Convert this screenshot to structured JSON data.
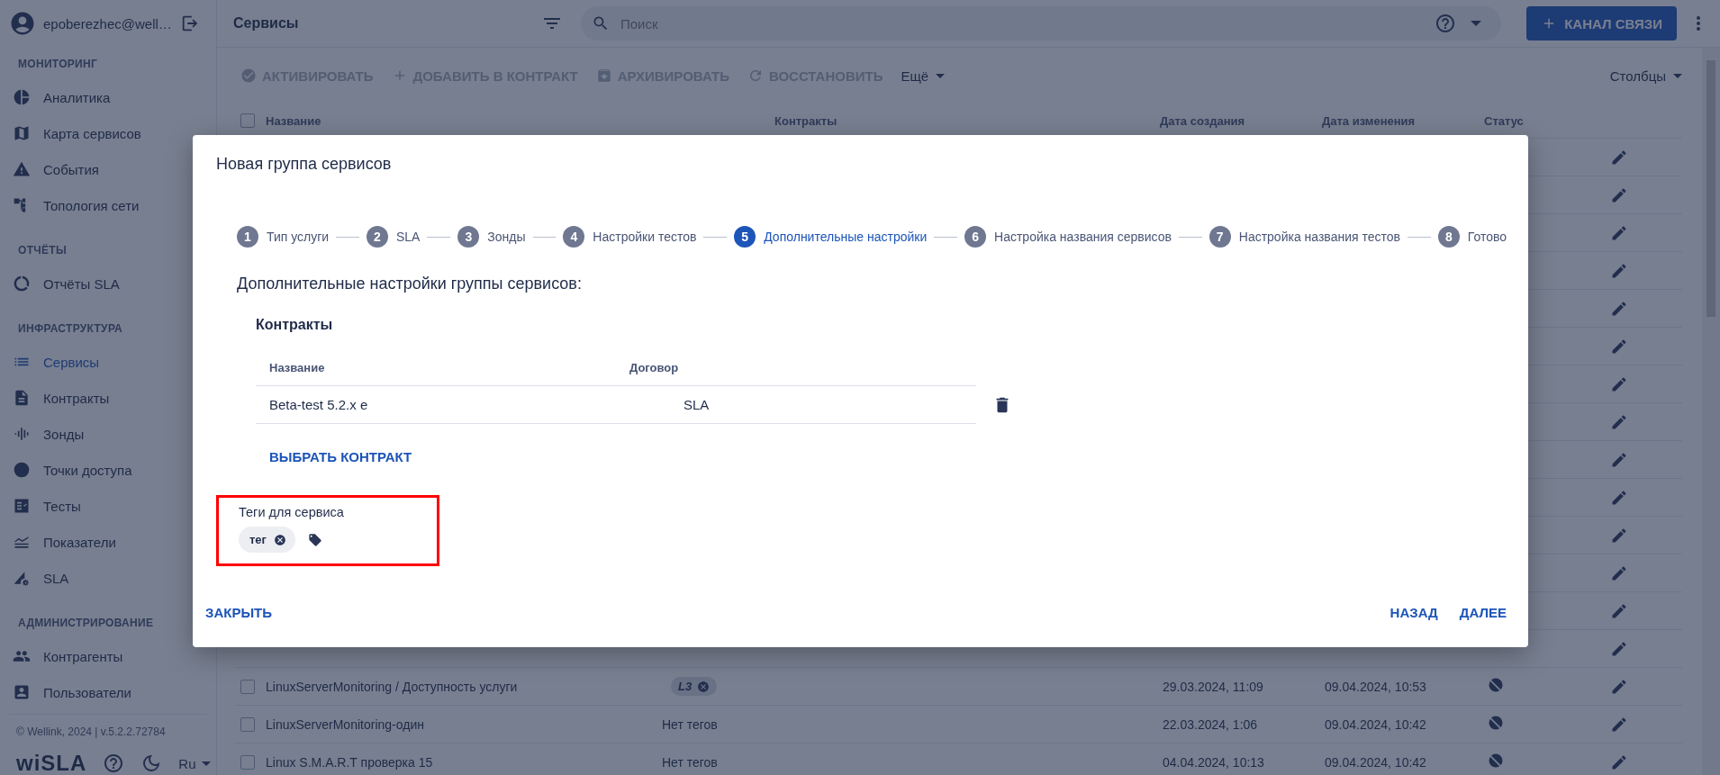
{
  "sidebar": {
    "user": "epoberezhec@well…",
    "sections": [
      {
        "title": "МОНИТОРИНГ",
        "items": [
          {
            "label": "Аналитика",
            "kind": "pie",
            "selected": false
          },
          {
            "label": "Карта сервисов",
            "kind": "map",
            "selected": false
          },
          {
            "label": "События",
            "kind": "warning",
            "selected": false
          },
          {
            "label": "Топология сети",
            "kind": "topology",
            "selected": false
          }
        ]
      },
      {
        "title": "ОТЧЁТЫ",
        "items": [
          {
            "label": "Отчёты SLA",
            "kind": "ring",
            "selected": false
          }
        ]
      },
      {
        "title": "ИНФРАСТРУКТУРА",
        "items": [
          {
            "label": "Сервисы",
            "kind": "list",
            "selected": true
          },
          {
            "label": "Контракты",
            "kind": "document",
            "selected": false
          },
          {
            "label": "Зонды",
            "kind": "wave",
            "selected": false
          },
          {
            "label": "Точки доступа",
            "kind": "dot",
            "selected": false
          },
          {
            "label": "Тесты",
            "kind": "checklist",
            "selected": false
          },
          {
            "label": "Показатели",
            "kind": "lines",
            "selected": false
          },
          {
            "label": "SLA",
            "kind": "slagear",
            "selected": false
          }
        ]
      },
      {
        "title": "АДМИНИСТРИРОВАНИЕ",
        "items": [
          {
            "label": "Контрагенты",
            "kind": "people",
            "selected": false
          },
          {
            "label": "Пользователи",
            "kind": "badge",
            "selected": false
          }
        ]
      }
    ],
    "footer": {
      "copyright": "© Wellink, 2024 | v.5.2.2.72784",
      "logo": "wiSLA",
      "language": "Ru"
    }
  },
  "topbar": {
    "title": "Сервисы",
    "search": {
      "placeholder": "Поиск"
    },
    "primary_button": "КАНАЛ СВЯЗИ"
  },
  "toolbar": {
    "actions": [
      {
        "label": "АКТИВИРОВАТЬ",
        "kind": "activate",
        "disabled": true
      },
      {
        "label": "ДОБАВИТЬ В КОНТРАКТ",
        "kind": "add",
        "disabled": true
      },
      {
        "label": "АРХИВИРОВАТЬ",
        "kind": "archive",
        "disabled": true
      },
      {
        "label": "ВОССТАНОВИТЬ",
        "kind": "restore",
        "disabled": true
      }
    ],
    "more": "Ещё",
    "columns_button": "Столбцы"
  },
  "table": {
    "select_all_checked": false,
    "columns": [
      "Название",
      "Контракты",
      "Дата создания",
      "Дата изменения",
      "Статус"
    ],
    "covered_rows": [
      {
        "kind": "covered"
      },
      {
        "kind": "covered"
      },
      {
        "kind": "covered"
      },
      {
        "kind": "covered"
      },
      {
        "kind": "covered"
      },
      {
        "kind": "covered"
      },
      {
        "kind": "covered"
      },
      {
        "kind": "covered"
      },
      {
        "kind": "covered"
      },
      {
        "kind": "covered"
      },
      {
        "kind": "covered"
      },
      {
        "kind": "covered"
      },
      {
        "kind": "covered"
      },
      {
        "kind": "covered"
      }
    ],
    "rows": [
      {
        "name": "LinuxServerMonitoring / Доступность услуги",
        "tags": [
          "L3"
        ],
        "created": "29.03.2024, 11:09",
        "modified": "09.04.2024, 10:53",
        "checked": false
      },
      {
        "name": "LinuxServerMonitoring-один",
        "tags": [],
        "contracts": "Нет тегов",
        "created": "22.03.2024, 1:06",
        "modified": "09.04.2024, 10:42",
        "checked": false
      },
      {
        "name": "Linux S.M.A.R.T проверка 15",
        "tags": [],
        "contracts": "Нет тегов",
        "created": "04.04.2024, 10:13",
        "modified": "09.04.2024, 10:42",
        "checked": false
      }
    ]
  },
  "modal": {
    "title": "Новая группа сервисов",
    "steps": [
      {
        "number": "1",
        "label": "Тип услуги",
        "selected": false
      },
      {
        "number": "2",
        "label": "SLA",
        "selected": false
      },
      {
        "number": "3",
        "label": "Зонды",
        "selected": false
      },
      {
        "number": "4",
        "label": "Настройки тестов",
        "selected": false
      },
      {
        "number": "5",
        "label": "Дополнительные настройки",
        "selected": true
      },
      {
        "number": "6",
        "label": "Настройка названия сервисов",
        "selected": false
      },
      {
        "number": "7",
        "label": "Настройка названия тестов",
        "selected": false
      },
      {
        "number": "8",
        "label": "Готово",
        "selected": false
      }
    ],
    "heading": "Дополнительные настройки группы сервисов:",
    "contracts": {
      "title": "Контракты",
      "columns": [
        "Название",
        "Договор"
      ],
      "rows": [
        {
          "name": "Beta-test 5.2.x e",
          "agreement": "SLA"
        }
      ],
      "select_link": "ВЫБРАТЬ КОНТРАКТ"
    },
    "tags": {
      "label": "Теги для сервиса",
      "highlighted": true,
      "chips": [
        "тег"
      ]
    },
    "buttons": {
      "close": "ЗАКРЫТЬ",
      "back": "НАЗАД",
      "next": "ДАЛЕЕ"
    }
  }
}
